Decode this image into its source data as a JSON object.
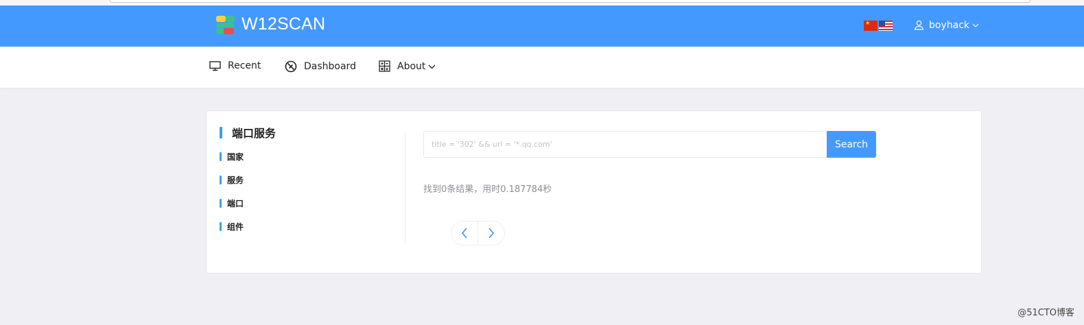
{
  "colors": {
    "header_bg": "#4499ff",
    "accent_bar": "#39a0ea",
    "page_bg": "#f0f0f4",
    "search_button": "#4499ff"
  },
  "header": {
    "brand": "W12SCAN",
    "logo_icon": "w12scan-logo-icon",
    "flags": [
      "cn-flag-icon",
      "us-flag-icon"
    ],
    "user": {
      "name": "boyhack",
      "icon": "user-icon"
    }
  },
  "nav": {
    "items": [
      {
        "label": "Recent",
        "icon": "monitor-icon"
      },
      {
        "label": "Dashboard",
        "icon": "dashboard-icon"
      },
      {
        "label": "About",
        "icon": "calculator-icon"
      }
    ]
  },
  "sidebar": {
    "title": "端口服务",
    "items": [
      {
        "label": "国家"
      },
      {
        "label": "服务"
      },
      {
        "label": "端口"
      },
      {
        "label": "组件"
      }
    ]
  },
  "search": {
    "placeholder": "title = '302' && url = '*.qq.com'",
    "value": "",
    "button_label": "Search"
  },
  "result": {
    "text": "找到0条结果，用时0.187784秒"
  },
  "pager": {
    "prev_icon": "chevron-left-icon",
    "next_icon": "chevron-right-icon"
  },
  "watermark": "@51CTO博客"
}
